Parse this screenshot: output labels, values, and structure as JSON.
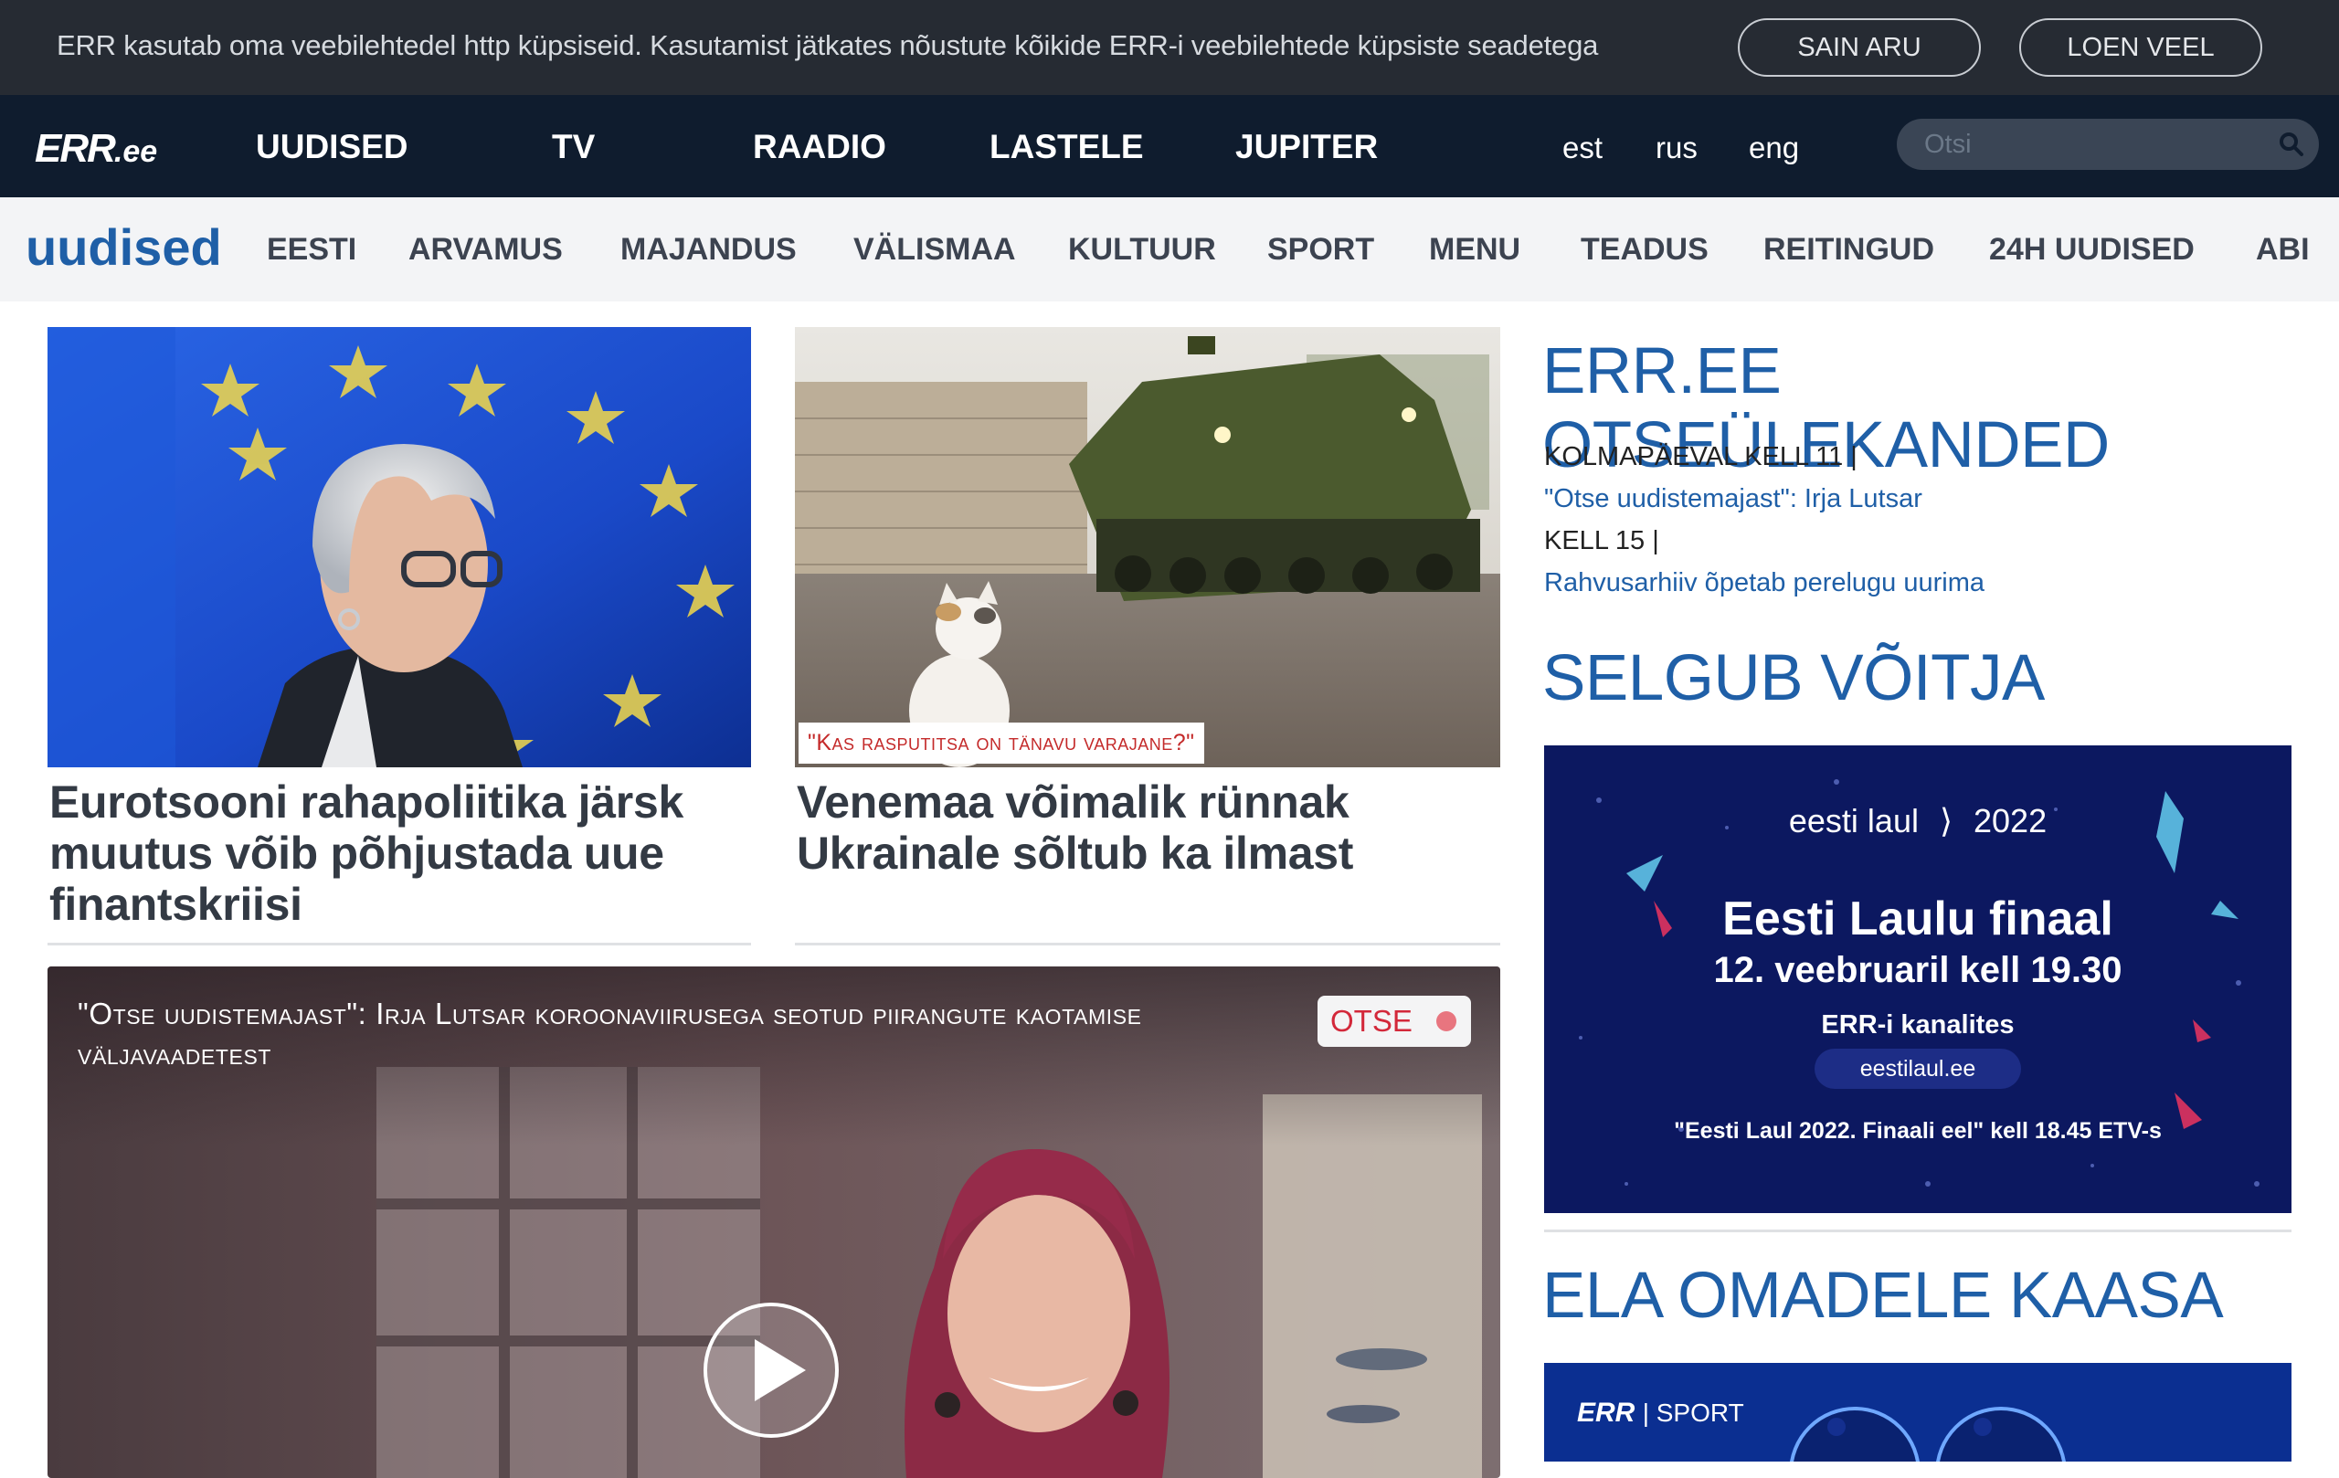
{
  "cookie": {
    "text": "ERR kasutab oma veebilehtedel http küpsiseid. Kasutamist jätkates nõustute kõikide ERR-i veebilehtede küpsiste seadetega",
    "accept_label": "SAIN ARU",
    "more_label": "LOEN VEEL"
  },
  "topnav": {
    "logo_main": "ERR",
    "logo_suffix": ".ee",
    "items": [
      "UUDISED",
      "TV",
      "RAADIO",
      "LASTELE",
      "JUPITER"
    ],
    "languages": [
      "est",
      "rus",
      "eng"
    ],
    "search_placeholder": "Otsi"
  },
  "section": {
    "title": "uudised",
    "items": [
      "EESTI",
      "ARVAMUS",
      "MAJANDUS",
      "VÄLISMAA",
      "KULTUUR",
      "SPORT",
      "MENU",
      "TEADUS",
      "REITINGUD",
      "24H UUDISED",
      "ABI"
    ]
  },
  "articles": [
    {
      "title": "Eurotsooni rahapoliitika järsk muutus võib põhjustada uue finantskriisi"
    },
    {
      "title": "Venemaa võimalik rünnak Ukrainale sõltub ka ilmast",
      "tag": "\"Kas rasputitsa on tänavu varajane?\""
    }
  ],
  "video": {
    "title": "\"Otse uudistemajast\": Irja Lutsar koroonaviirusega seotud piirangute kaotamise väljavaadetest",
    "live_label": "OTSE"
  },
  "sidebar": {
    "broadcasts_heading": "ERR.EE OTSEÜLEKANDED",
    "broadcasts": [
      {
        "time": "KOLMAPÄEVAL KELL 11 |",
        "link": "\"Otse uudistemajast\": Irja Lutsar"
      },
      {
        "time": "KELL 15 |",
        "link": "Rahvusarhiiv õpetab perelugu uurima"
      }
    ],
    "winner_heading": "SELGUB VÕITJA",
    "banner": {
      "brand": "eesti laul",
      "year": "2022",
      "headline": "Eesti Laulu finaal",
      "date": "12. veebruaril kell 19.30",
      "channels": "ERR-i kanalites",
      "url": "eestilaul.ee",
      "footer": "\"Eesti Laul 2022. Finaali eel\" kell 18.45 ETV-s"
    },
    "cheer_heading": "ELA OMADELE KAASA",
    "banner2_label": "| SPORT"
  },
  "colors": {
    "accent": "#1f5fa7",
    "topbar": "#0f1c2e",
    "cookiebar": "#262b33",
    "live": "#d3283a"
  }
}
